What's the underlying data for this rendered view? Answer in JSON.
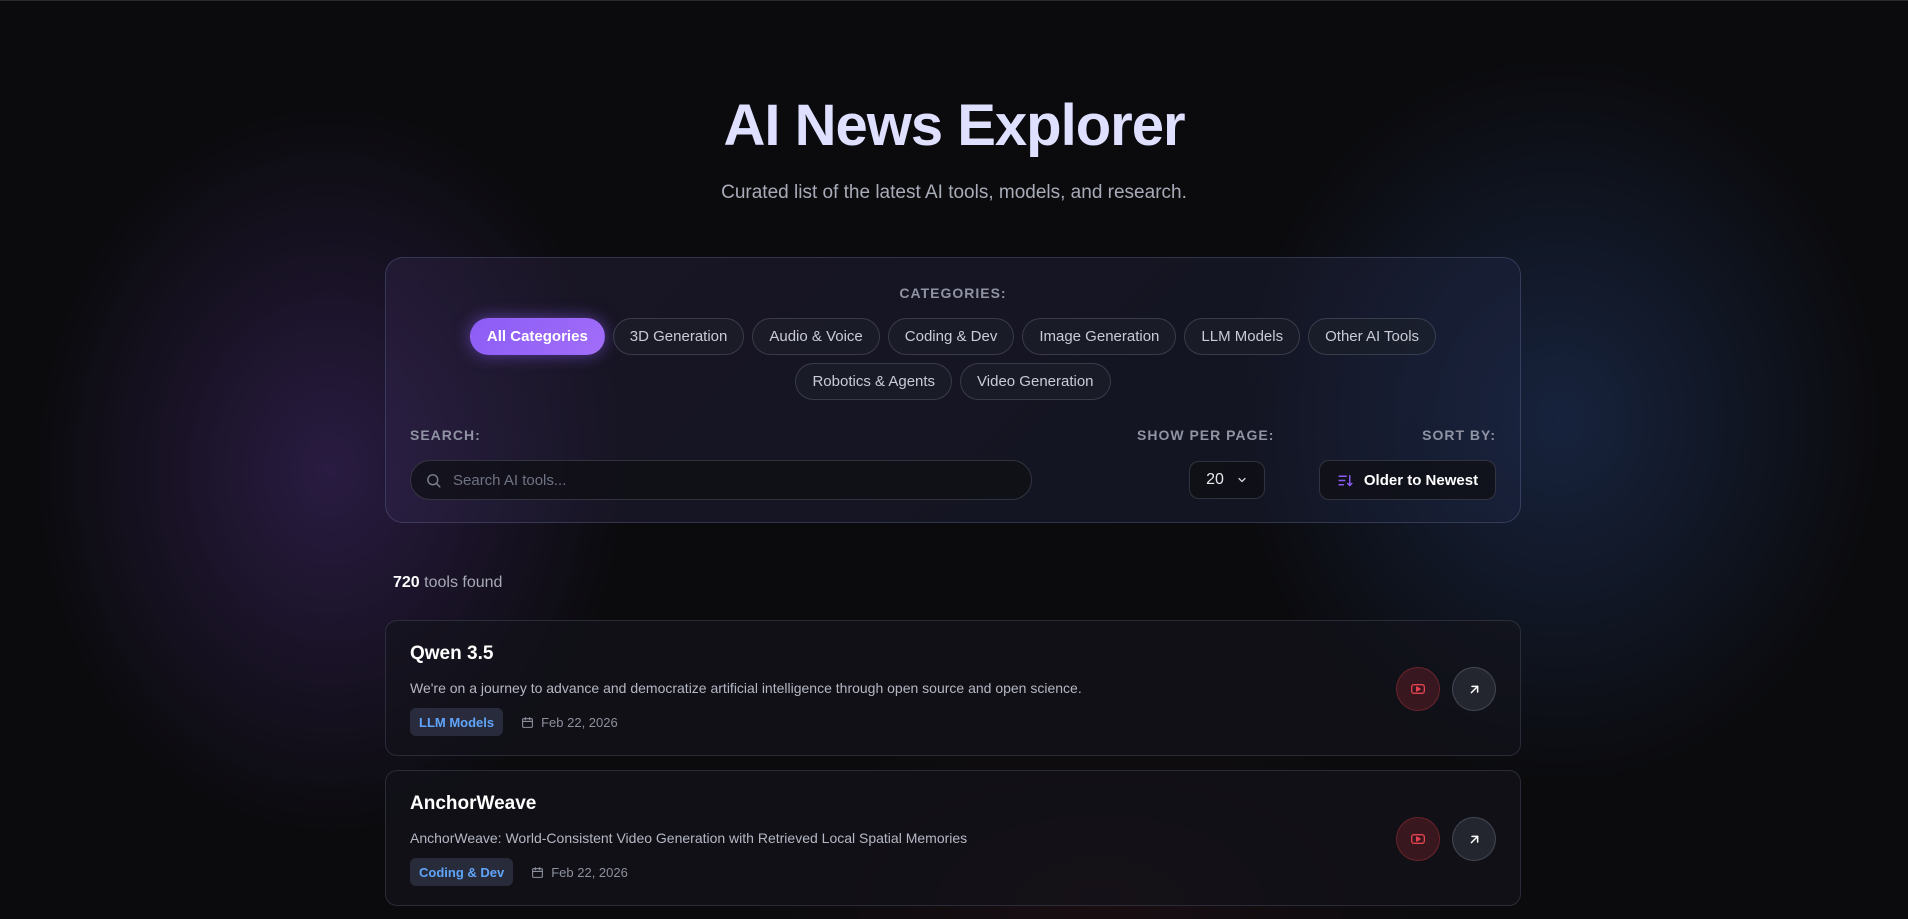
{
  "header": {
    "title": "AI News Explorer",
    "subtitle": "Curated list of the latest AI tools, models, and research."
  },
  "filters": {
    "categories_label": "CATEGORIES:",
    "categories": [
      "All Categories",
      "3D Generation",
      "Audio & Voice",
      "Coding & Dev",
      "Image Generation",
      "LLM Models",
      "Other AI Tools",
      "Robotics & Agents",
      "Video Generation"
    ],
    "active_category": "All Categories",
    "search_label": "SEARCH:",
    "search_placeholder": "Search AI tools...",
    "search_value": "",
    "per_page_label": "SHOW PER PAGE:",
    "per_page_value": "20",
    "sort_label": "SORT BY:",
    "sort_value": "Older to Newest"
  },
  "results": {
    "count": "720",
    "count_suffix": "tools found"
  },
  "cards": [
    {
      "title": "Qwen 3.5",
      "description": "We're on a journey to advance and democratize artificial intelligence through open source and open science.",
      "tag": "LLM Models",
      "date": "Feb 22, 2026"
    },
    {
      "title": "AnchorWeave",
      "description": "AnchorWeave: World-Consistent Video Generation with Retrieved Local Spatial Memories",
      "tag": "Coding & Dev",
      "date": "Feb 22, 2026"
    }
  ],
  "colors": {
    "accent": "#8b5cf6",
    "tag_text": "#60a5fa",
    "youtube_red": "#e2434f",
    "background": "#0b0b0e"
  },
  "icons": {
    "search": "search-icon",
    "chevron": "chevron-down-icon",
    "sort": "sort-icon",
    "calendar": "calendar-icon",
    "youtube": "youtube-icon",
    "external": "external-link-icon"
  }
}
